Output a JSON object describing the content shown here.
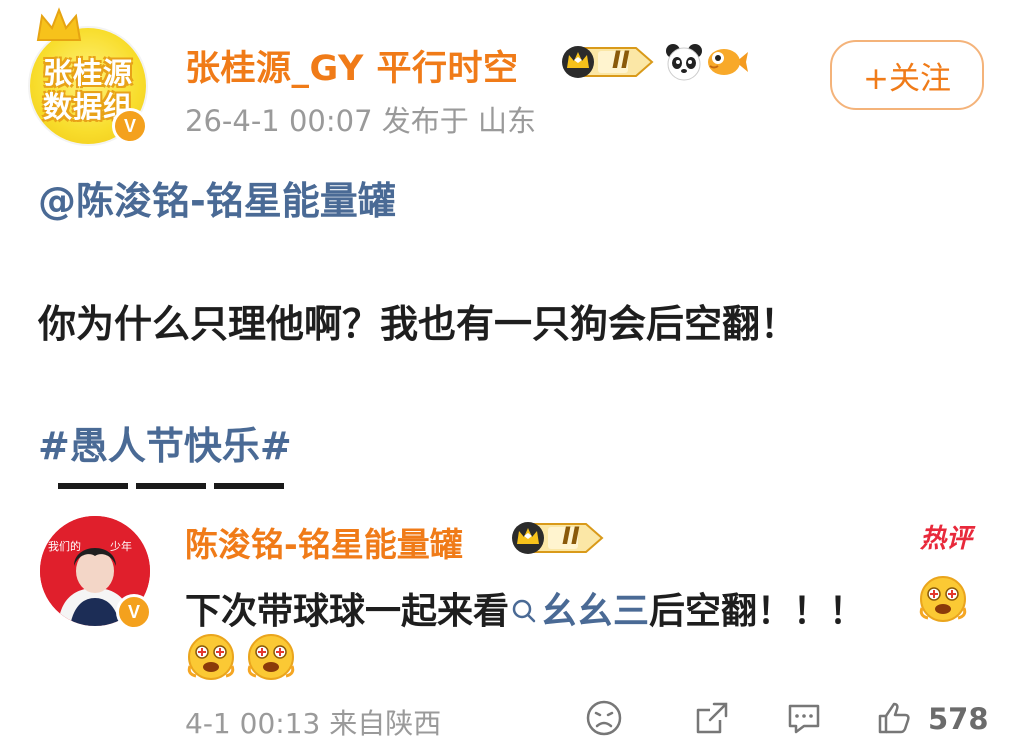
{
  "post": {
    "avatar_text_line1": "张桂源",
    "avatar_text_line2": "数据组",
    "username": "张桂源_GY 平行时空",
    "level_badge": "II",
    "meta": "26-4-1 00:07  发布于 山东",
    "follow_label": "+关注",
    "mention": "@陈浚铭-铭星能量罐",
    "text": "你为什么只理他啊？我也有一只狗会后空翻！",
    "hashtag": "#愚人节快乐#"
  },
  "comment": {
    "username": "陈浚铭-铭星能量罐",
    "level_badge": "II",
    "hot_tag": "热评",
    "text_before": "下次带球球一起来看",
    "search_link": "幺幺三",
    "text_after": "后空翻！！！",
    "meta": "4-1 00:13  来自陕西",
    "like_count": "578"
  },
  "colors": {
    "username": "#f07b18",
    "link": "#4a6a95",
    "meta": "#9a9a9a",
    "hot": "#e8293b"
  },
  "icons": [
    "crown-icon",
    "verified-v-icon",
    "panda-icon",
    "fish-icon",
    "grin-emoji-icon",
    "sad-face-icon",
    "share-icon",
    "comment-icon",
    "thumbs-up-icon",
    "search-icon"
  ]
}
